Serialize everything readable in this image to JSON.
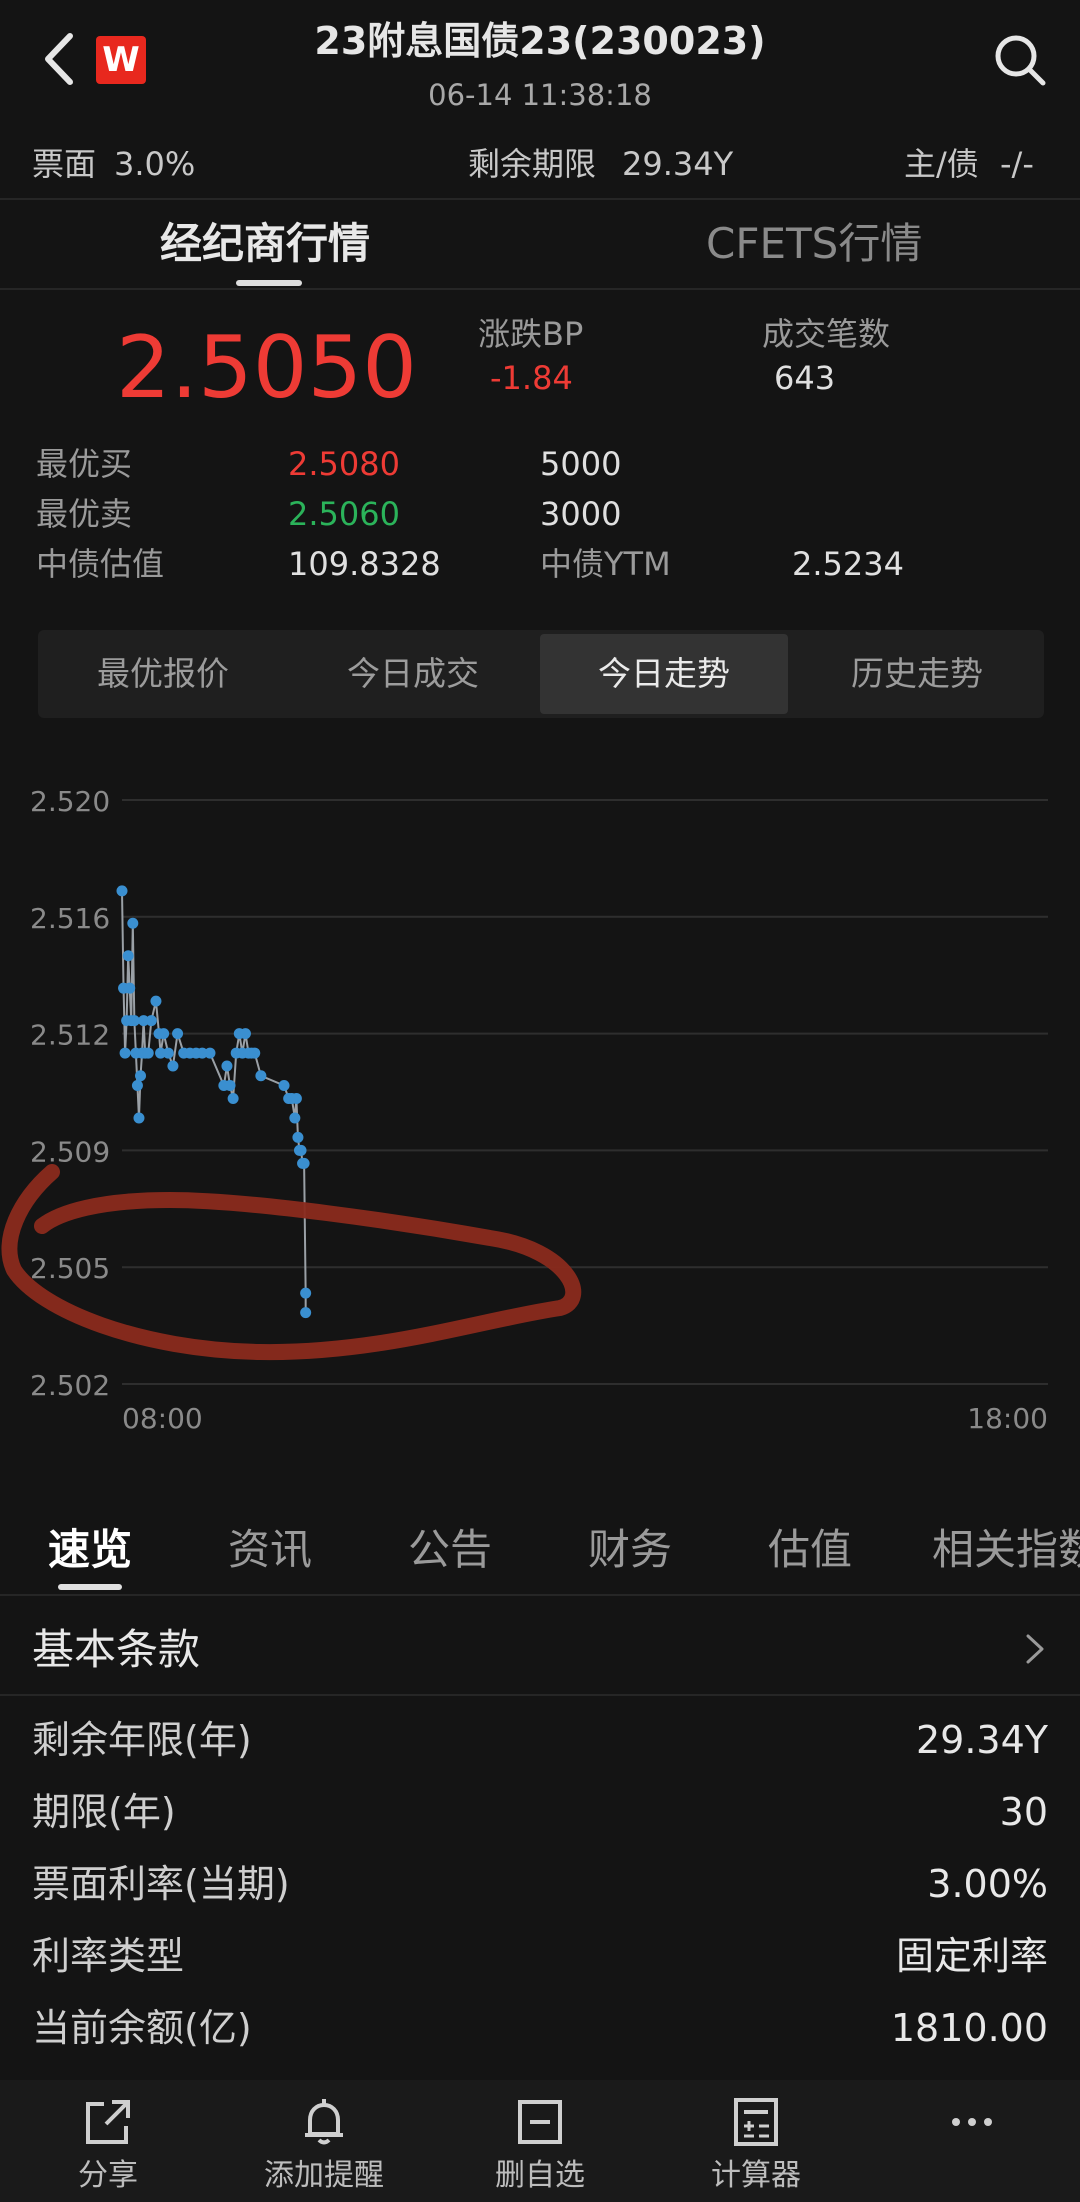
{
  "header": {
    "title": "23附息国债23(230023)",
    "datetime": "06-14 11:38:18",
    "brand_badge": "W"
  },
  "info_bar": {
    "coupon_label": "票面",
    "coupon_value": "3.0%",
    "remaining_label": "剩余期限",
    "remaining_value": "29.34Y",
    "rating_label": "主/债",
    "rating_value": "-/-"
  },
  "main_tabs": [
    {
      "label": "经纪商行情",
      "active": true
    },
    {
      "label": "CFETS行情",
      "active": false
    }
  ],
  "quote": {
    "last_price": "2.5050",
    "change_label": "涨跌BP",
    "change_value": "-1.84",
    "trades_label": "成交笔数",
    "trades_value": "643",
    "best_bid_label": "最优买",
    "best_bid_price": "2.5080",
    "best_bid_volume": "5000",
    "best_ask_label": "最优卖",
    "best_ask_price": "2.5060",
    "best_ask_volume": "3000",
    "valuation_label": "中债估值",
    "valuation_value": "109.8328",
    "ytm_label": "中债YTM",
    "ytm_value": "2.5234"
  },
  "segment_tabs": [
    {
      "label": "最优报价",
      "active": false
    },
    {
      "label": "今日成交",
      "active": false
    },
    {
      "label": "今日走势",
      "active": true
    },
    {
      "label": "历史走势",
      "active": false
    }
  ],
  "chart_data": {
    "type": "line",
    "y_ticks": [
      "2.520",
      "2.516",
      "2.512",
      "2.509",
      "2.505",
      "2.502"
    ],
    "x_ticks": [
      "08:00",
      "18:00"
    ],
    "ylim": [
      2.502,
      2.52
    ],
    "x_range": [
      "08:00",
      "18:00"
    ],
    "grid": true,
    "series": [
      {
        "color": "#3a8fd0",
        "x": [
          "08:00",
          "08:01",
          "08:02",
          "08:03",
          "08:04",
          "08:05",
          "08:06",
          "08:07",
          "08:08",
          "08:09",
          "08:10",
          "08:11",
          "08:12",
          "08:13",
          "08:14",
          "08:15",
          "08:17",
          "08:19",
          "08:22",
          "08:24",
          "08:25",
          "08:27",
          "08:30",
          "08:33",
          "08:36",
          "08:40",
          "08:44",
          "08:48",
          "08:52",
          "08:57",
          "09:06",
          "09:08",
          "09:10",
          "09:12",
          "09:14",
          "09:16",
          "09:18",
          "09:20",
          "09:22",
          "09:24",
          "09:26",
          "09:30",
          "09:45",
          "09:48",
          "09:50",
          "09:52",
          "09:53",
          "09:54",
          "09:55",
          "09:56",
          "09:57",
          "09:58",
          "09:59",
          "09:59"
        ],
        "y": [
          2.5172,
          2.5142,
          2.5122,
          2.5132,
          2.5152,
          2.5142,
          2.5132,
          2.5162,
          2.5132,
          2.5122,
          2.5112,
          2.5102,
          2.5115,
          2.5122,
          2.5132,
          2.5122,
          2.5122,
          2.5132,
          2.5138,
          2.5128,
          2.5122,
          2.5128,
          2.5122,
          2.5118,
          2.5128,
          2.5122,
          2.5122,
          2.5122,
          2.5122,
          2.5122,
          2.5112,
          2.5118,
          2.5112,
          2.5108,
          2.5122,
          2.5128,
          2.5122,
          2.5128,
          2.5122,
          2.5122,
          2.5122,
          2.5115,
          2.5112,
          2.5108,
          2.5108,
          2.5102,
          2.5108,
          2.5096,
          2.5092,
          2.5092,
          2.5088,
          2.5088,
          2.5048,
          2.5042
        ]
      }
    ]
  },
  "sub_tabs": [
    {
      "label": "速览",
      "active": true
    },
    {
      "label": "资讯",
      "active": false
    },
    {
      "label": "公告",
      "active": false
    },
    {
      "label": "财务",
      "active": false
    },
    {
      "label": "估值",
      "active": false
    },
    {
      "label": "相关指数",
      "active": false
    }
  ],
  "basic_terms": {
    "title": "基本条款",
    "rows": [
      {
        "label": "剩余年限(年)",
        "value": "29.34Y"
      },
      {
        "label": "期限(年)",
        "value": "30"
      },
      {
        "label": "票面利率(当期)",
        "value": "3.00%"
      },
      {
        "label": "利率类型",
        "value": "固定利率"
      },
      {
        "label": "当前余额(亿)",
        "value": "1810.00"
      }
    ]
  },
  "bottom_bar": [
    {
      "label": "分享",
      "icon": "share-icon"
    },
    {
      "label": "添加提醒",
      "icon": "bell-icon"
    },
    {
      "label": "删自选",
      "icon": "remove-watchlist-icon"
    },
    {
      "label": "计算器",
      "icon": "calculator-icon"
    },
    {
      "label": "",
      "icon": "more-icon"
    }
  ],
  "colors": {
    "up": "#ee3b35",
    "down": "#2bb35a",
    "line": "#3a8fd0",
    "annotation": "#8a2a1c"
  }
}
